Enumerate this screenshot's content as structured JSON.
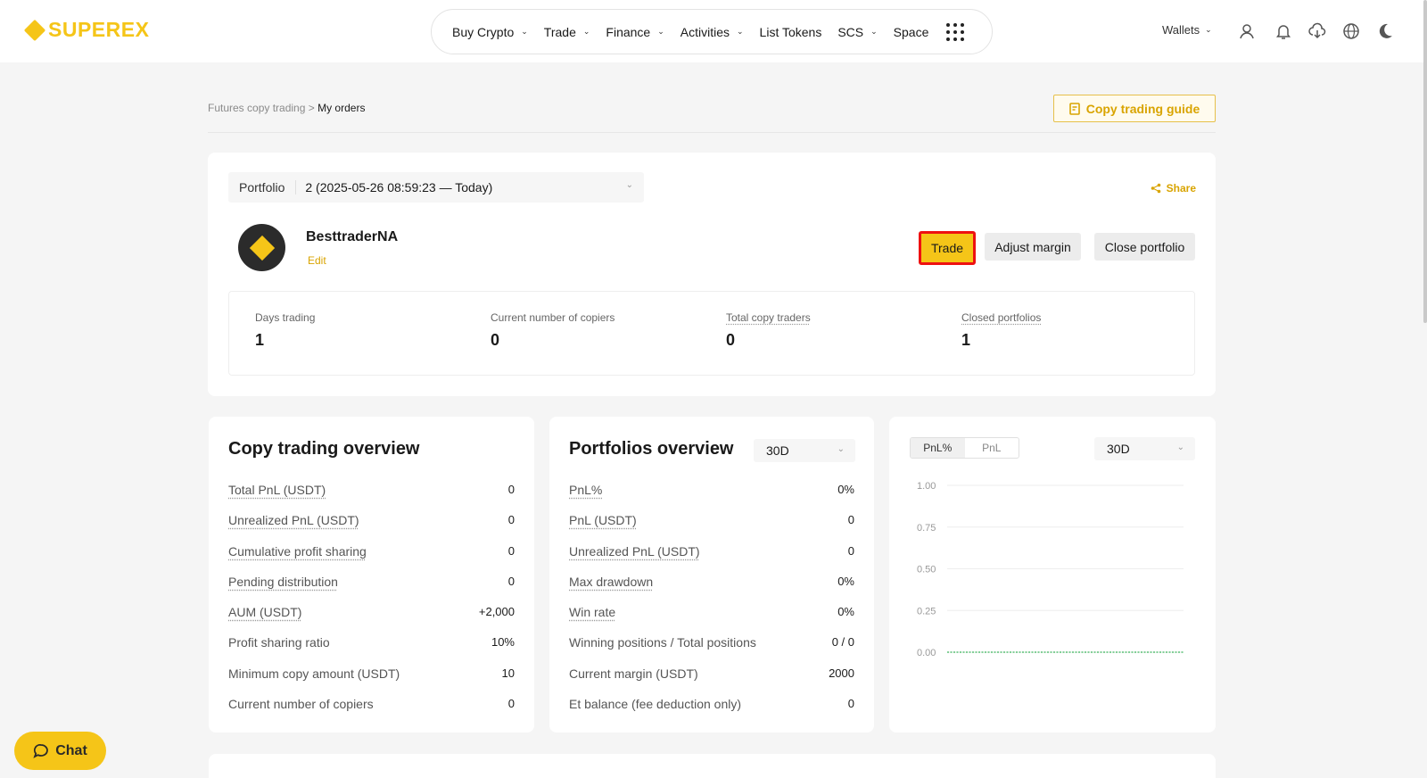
{
  "brand": {
    "name": "SUPEREX",
    "color": "#f5c518"
  },
  "nav": {
    "items": [
      {
        "label": "Buy Crypto",
        "has_menu": true
      },
      {
        "label": "Trade",
        "has_menu": true
      },
      {
        "label": "Finance",
        "has_menu": true
      },
      {
        "label": "Activities",
        "has_menu": true
      },
      {
        "label": "List Tokens",
        "has_menu": false
      },
      {
        "label": "SCS",
        "has_menu": true
      },
      {
        "label": "Space",
        "has_menu": false
      }
    ],
    "wallets_label": "Wallets",
    "icons": [
      "user-icon",
      "bell-icon",
      "download-icon",
      "globe-icon",
      "moon-icon"
    ]
  },
  "breadcrumb": {
    "parent": "Futures copy trading",
    "separator": ">",
    "current": "My orders"
  },
  "guide_button": "Copy trading guide",
  "portfolio": {
    "select_label": "Portfolio",
    "select_value": "2  (2025-05-26 08:59:23 — Today)",
    "share_label": "Share",
    "username": "BesttraderNA",
    "edit_label": "Edit",
    "buttons": {
      "trade": "Trade",
      "adjust": "Adjust margin",
      "close": "Close portfolio"
    },
    "stats": [
      {
        "label": "Days trading",
        "value": "1"
      },
      {
        "label": "Current number of copiers",
        "value": "0"
      },
      {
        "label": "Total copy traders",
        "value": "0"
      },
      {
        "label": "Closed portfolios",
        "value": "1"
      }
    ]
  },
  "copy_overview": {
    "title": "Copy trading overview",
    "rows": [
      {
        "label": "Total PnL (USDT)",
        "value": "0"
      },
      {
        "label": "Unrealized PnL (USDT)",
        "value": "0"
      },
      {
        "label": "Cumulative profit sharing",
        "value": "0"
      },
      {
        "label": "Pending distribution",
        "value": "0"
      },
      {
        "label": "AUM (USDT)",
        "value": "+2,000"
      },
      {
        "label": "Profit sharing ratio",
        "value": "10%"
      },
      {
        "label": "Minimum copy amount (USDT)",
        "value": "10"
      },
      {
        "label": "Current number of copiers",
        "value": "0"
      }
    ]
  },
  "portfolios_overview": {
    "title": "Portfolios overview",
    "period": "30D",
    "rows": [
      {
        "label": "PnL%",
        "value": "0%"
      },
      {
        "label": "PnL (USDT)",
        "value": "0"
      },
      {
        "label": "Unrealized PnL (USDT)",
        "value": "0"
      },
      {
        "label": "Max drawdown",
        "value": "0%"
      },
      {
        "label": "Win rate",
        "value": "0%"
      },
      {
        "label": "Winning positions / Total positions",
        "value": "0 / 0"
      },
      {
        "label": "Current margin (USDT)",
        "value": "2000"
      },
      {
        "label": "Et balance (fee deduction only)",
        "value": "0"
      }
    ]
  },
  "pnl_chart": {
    "toggle": [
      "PnL%",
      "PnL"
    ],
    "active_toggle": "PnL%",
    "period": "30D",
    "chart_data": {
      "type": "line",
      "y_ticks": [
        "1.00",
        "0.75",
        "0.50",
        "0.25",
        "0.00"
      ],
      "ylim": [
        0,
        1
      ],
      "series": [
        {
          "values": [
            0,
            0
          ]
        }
      ],
      "line_color": "#3bb55b"
    }
  },
  "chat_label": "Chat"
}
